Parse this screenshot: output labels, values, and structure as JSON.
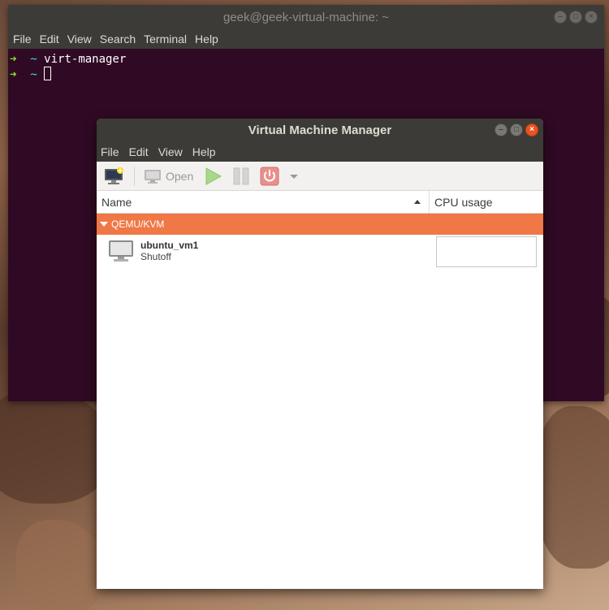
{
  "terminal": {
    "title": "geek@geek-virtual-machine: ~",
    "menu": [
      "File",
      "Edit",
      "View",
      "Search",
      "Terminal",
      "Help"
    ],
    "prompt_arrow": "➜",
    "prompt_dir": "~",
    "lines": [
      {
        "command": "virt-manager"
      },
      {
        "command": ""
      }
    ]
  },
  "vmm": {
    "title": "Virtual Machine Manager",
    "menu": [
      "File",
      "Edit",
      "View",
      "Help"
    ],
    "toolbar": {
      "open_label": "Open"
    },
    "columns": {
      "name": "Name",
      "cpu": "CPU usage"
    },
    "group": {
      "label": "QEMU/KVM"
    },
    "vms": [
      {
        "name": "ubuntu_vm1",
        "status": "Shutoff"
      }
    ]
  },
  "colors": {
    "terminal_bg": "#300a24",
    "titlebar": "#3c3b37",
    "accent": "#f07746",
    "close": "#e95420",
    "prompt_arrow": "#8ae234",
    "prompt_dir": "#34e2e2"
  },
  "icons": [
    "new-vm-icon",
    "monitor-icon",
    "run-icon",
    "pause-icon",
    "shutdown-icon",
    "dropdown-arrow-icon"
  ]
}
